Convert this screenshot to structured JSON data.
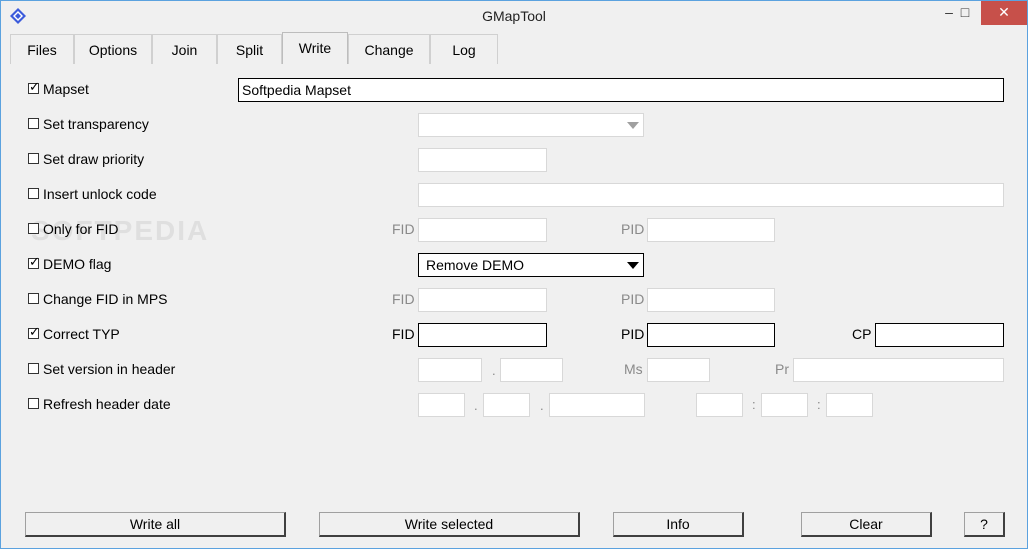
{
  "window": {
    "title": "GMapTool",
    "minimize": "–",
    "maximize": "□",
    "close": "✕"
  },
  "tabs": [
    {
      "label": "Files"
    },
    {
      "label": "Options"
    },
    {
      "label": "Join"
    },
    {
      "label": "Split"
    },
    {
      "label": "Write",
      "active": true
    },
    {
      "label": "Change"
    },
    {
      "label": "Log"
    }
  ],
  "rows": {
    "mapset": {
      "label": "Mapset",
      "checked": true,
      "value": "Softpedia Mapset"
    },
    "transparency": {
      "label": "Set transparency",
      "checked": false,
      "value": ""
    },
    "draw_priority": {
      "label": "Set draw priority",
      "checked": false,
      "value": ""
    },
    "unlock_code": {
      "label": "Insert unlock code",
      "checked": false,
      "value": ""
    },
    "only_fid": {
      "label": "Only for FID",
      "checked": false,
      "fid_label": "FID",
      "pid_label": "PID"
    },
    "demo": {
      "label": "DEMO flag",
      "checked": true,
      "value": "Remove DEMO"
    },
    "change_fid": {
      "label": "Change FID in MPS",
      "checked": false,
      "fid_label": "FID",
      "pid_label": "PID"
    },
    "correct_typ": {
      "label": "Correct TYP",
      "checked": true,
      "fid_label": "FID",
      "pid_label": "PID",
      "cp_label": "CP"
    },
    "version": {
      "label": "Set version in header",
      "checked": false,
      "dot": ".",
      "ms_label": "Ms",
      "pr_label": "Pr"
    },
    "refresh_date": {
      "label": "Refresh header date",
      "checked": false,
      "dot1": ".",
      "dot2": ".",
      "colon1": ":",
      "colon2": ":"
    }
  },
  "buttons": {
    "write_all": "Write all",
    "write_selected": "Write selected",
    "info": "Info",
    "clear": "Clear",
    "help": "?"
  },
  "check_mark": "✓"
}
